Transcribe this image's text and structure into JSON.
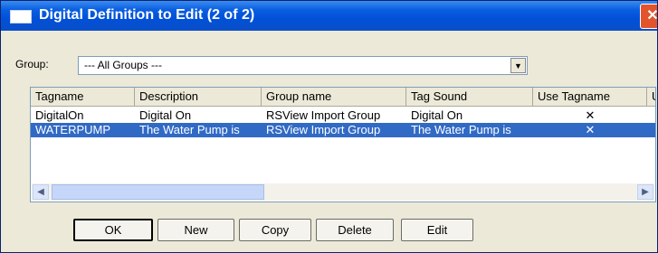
{
  "window": {
    "title": "Digital Definition to Edit (2 of 2)",
    "close_label": "✕"
  },
  "group": {
    "label": "Group:",
    "selected": "--- All Groups ---"
  },
  "table": {
    "columns": [
      "Tagname",
      "Description",
      "Group name",
      "Tag Sound",
      "Use Tagname",
      "U"
    ],
    "rows": [
      {
        "tagname": "DigitalOn",
        "description": "Digital On",
        "group_name": "RSView Import Group",
        "tag_sound": "Digital On",
        "use_tagname": "✕",
        "selected": false
      },
      {
        "tagname": "WATERPUMP",
        "description": "The Water Pump is",
        "group_name": "RSView Import Group",
        "tag_sound": "The Water Pump is",
        "use_tagname": "✕",
        "selected": true
      }
    ]
  },
  "scrollbar": {
    "left_arrow": "◀",
    "right_arrow": "▶"
  },
  "buttons": {
    "ok": "OK",
    "new": "New",
    "copy": "Copy",
    "delete": "Delete",
    "edit": "Edit"
  },
  "colors": {
    "titlebar": "#0050d8",
    "selection": "#316ac5",
    "dialog_bg": "#ece9d8"
  }
}
